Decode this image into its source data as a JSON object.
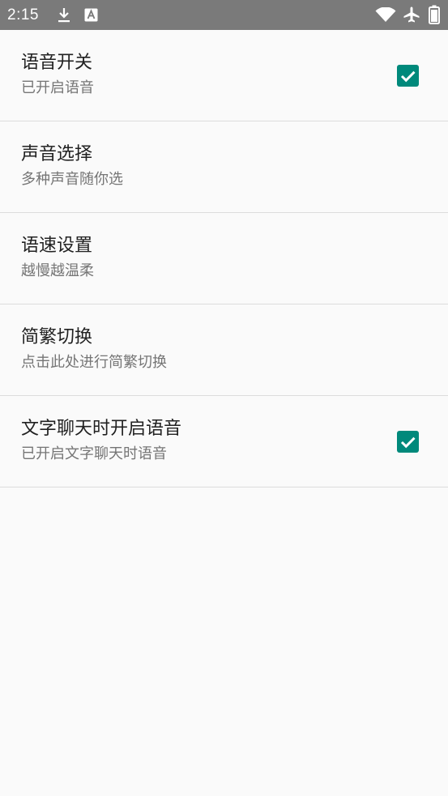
{
  "status_bar": {
    "time": "2:15",
    "icons": [
      "download-icon",
      "a-notification-icon",
      "wifi-icon",
      "airplane-mode-icon",
      "battery-icon"
    ]
  },
  "colors": {
    "accent": "#00897b",
    "status_bar": "#7a7a7a",
    "background": "#fafafa",
    "title_text": "#212121",
    "summary_text": "#757575",
    "divider": "#dcdcdc"
  },
  "preferences": [
    {
      "title": "语音开关",
      "summary": "已开启语音",
      "has_checkbox": true,
      "checked": true
    },
    {
      "title": "声音选择",
      "summary": "多种声音随你选",
      "has_checkbox": false
    },
    {
      "title": "语速设置",
      "summary": "越慢越温柔",
      "has_checkbox": false
    },
    {
      "title": "简繁切换",
      "summary": "点击此处进行简繁切换",
      "has_checkbox": false
    },
    {
      "title": "文字聊天时开启语音",
      "summary": "已开启文字聊天时语音",
      "has_checkbox": true,
      "checked": true
    }
  ]
}
